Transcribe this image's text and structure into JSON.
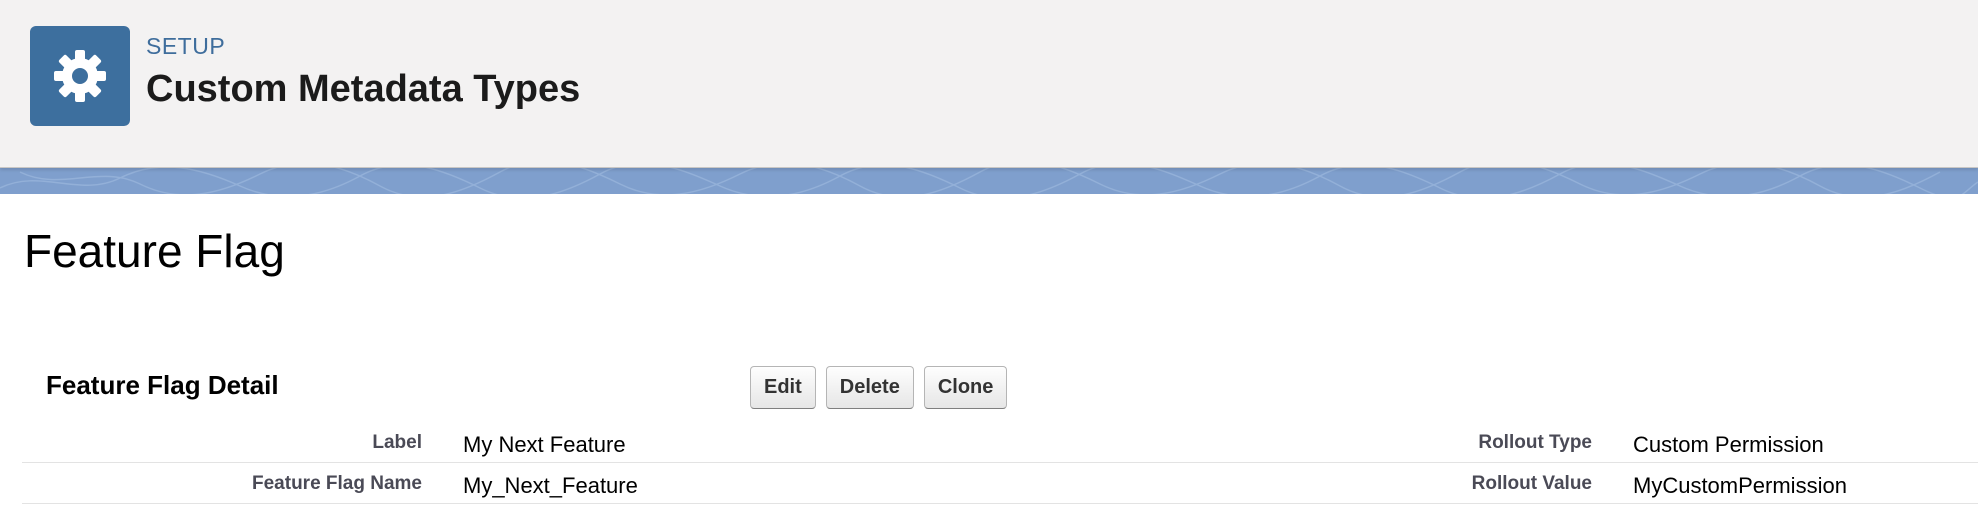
{
  "header": {
    "eyebrow": "SETUP",
    "title": "Custom Metadata Types",
    "icon": "gear-icon",
    "icon_color": "#3d6f9e"
  },
  "banner": {
    "color": "#7f9fcd"
  },
  "page": {
    "title": "Feature Flag"
  },
  "detail": {
    "section_title": "Feature Flag Detail",
    "buttons": {
      "edit": "Edit",
      "delete": "Delete",
      "clone": "Clone"
    },
    "rows": [
      {
        "left_label": "Label",
        "left_value": "My Next Feature",
        "right_label": "Rollout Type",
        "right_value": "Custom Permission"
      },
      {
        "left_label": "Feature Flag Name",
        "left_value": "My_Next_Feature",
        "right_label": "Rollout Value",
        "right_value": "MyCustomPermission"
      }
    ]
  }
}
